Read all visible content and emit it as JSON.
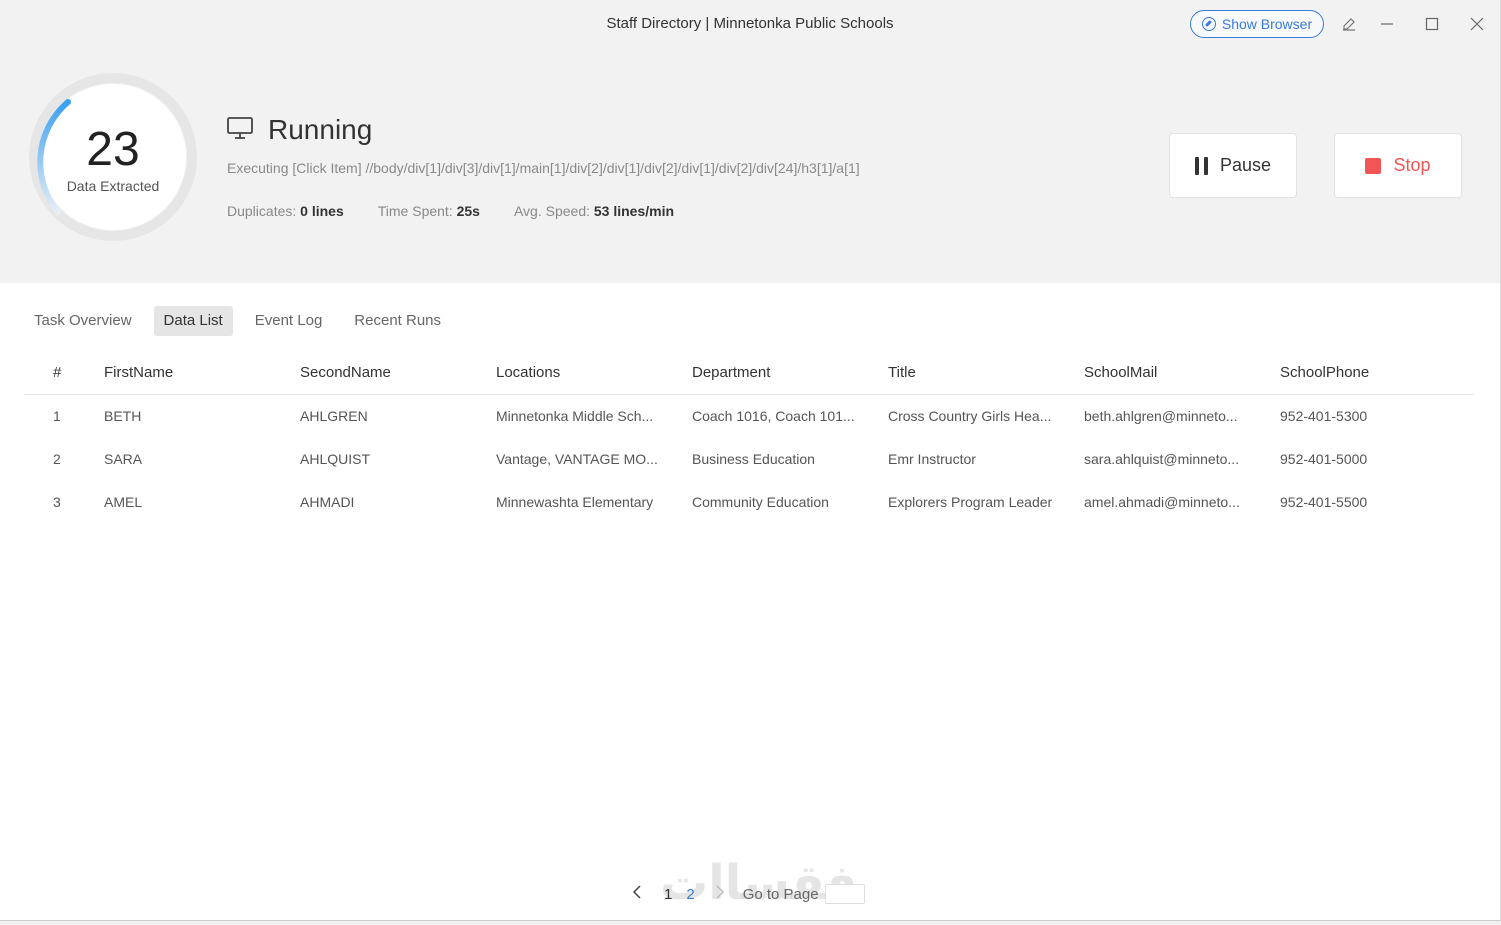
{
  "window": {
    "title": "Staff Directory | Minnetonka Public Schools",
    "show_browser_label": "Show Browser"
  },
  "progress": {
    "count": "23",
    "count_label": "Data Extracted",
    "status": "Running",
    "executing": "Executing [Click Item] //body/div[1]/div[3]/div[1]/main[1]/div[2]/div[1]/div[2]/div[1]/div[2]/div[24]/h3[1]/a[1]",
    "duplicates_label": "Duplicates:",
    "duplicates_value": "0 lines",
    "time_label": "Time Spent:",
    "time_value": "25s",
    "speed_label": "Avg. Speed:",
    "speed_value": "53 lines/min",
    "ring_color": "#3aa0f0"
  },
  "controls": {
    "pause_label": "Pause",
    "stop_label": "Stop",
    "stop_color": "#f25555"
  },
  "tabs": [
    {
      "label": "Task Overview",
      "active": false
    },
    {
      "label": "Data List",
      "active": true
    },
    {
      "label": "Event Log",
      "active": false
    },
    {
      "label": "Recent Runs",
      "active": false
    }
  ],
  "table": {
    "columns": [
      "#",
      "FirstName",
      "SecondName",
      "Locations",
      "Department",
      "Title",
      "SchoolMail",
      "SchoolPhone"
    ],
    "rows": [
      [
        "1",
        "BETH",
        "AHLGREN",
        "Minnetonka Middle Sch...",
        "Coach 1016, Coach 101...",
        "Cross Country Girls Hea...",
        "beth.ahlgren@minneto...",
        "952-401-5300"
      ],
      [
        "2",
        "SARA",
        "AHLQUIST",
        "Vantage, VANTAGE MO...",
        "Business Education",
        "Emr Instructor",
        "sara.ahlquist@minneto...",
        "952-401-5000"
      ],
      [
        "3",
        "AMEL",
        "AHMADI",
        "Minnewashta Elementary",
        "Community Education",
        "Explorers Program Leader",
        "amel.ahmadi@minneto...",
        "952-401-5500"
      ]
    ]
  },
  "pagination": {
    "page1": "1",
    "page2": "2",
    "goto_label": "Go to Page"
  },
  "watermark": "فقساات",
  "icons": {
    "monitor": "monitor-icon",
    "compass": "compass-icon",
    "edit": "edit-icon",
    "minimize": "minimize-icon",
    "maximize": "maximize-icon",
    "close": "close-icon"
  }
}
